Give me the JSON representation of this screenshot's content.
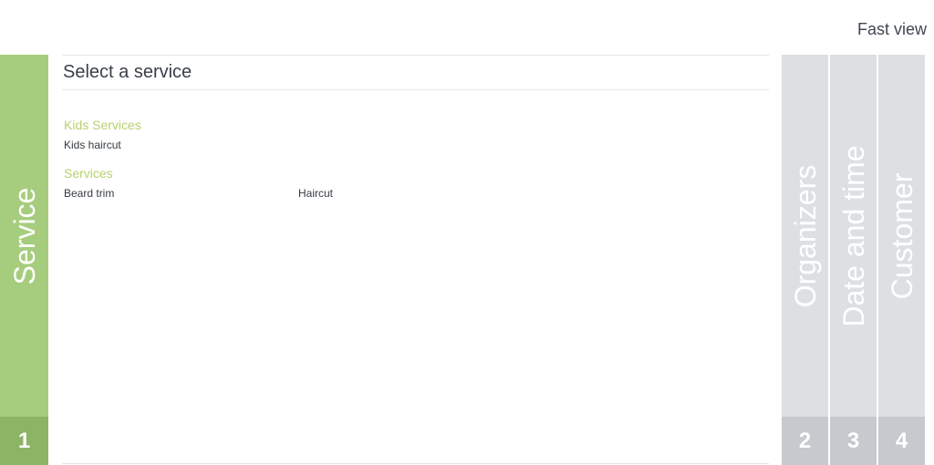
{
  "header": {
    "fast_view_label": "Fast view"
  },
  "steps": [
    {
      "number": "1",
      "label": "Service"
    },
    {
      "number": "2",
      "label": "Organizers"
    },
    {
      "number": "3",
      "label": "Date and time"
    },
    {
      "number": "4",
      "label": "Customer"
    }
  ],
  "main": {
    "title": "Select a service",
    "categories": [
      {
        "title": "Kids Services",
        "services": [
          "Kids haircut"
        ]
      },
      {
        "title": "Services",
        "services": [
          "Beard trim",
          "Haircut"
        ]
      }
    ]
  },
  "colors": {
    "active_step": "#a6cd7d",
    "active_step_number": "#8cb465",
    "pending_step": "#dde0e3",
    "pending_step_number": "#c6c9cd",
    "category_title": "#b5d36e"
  }
}
